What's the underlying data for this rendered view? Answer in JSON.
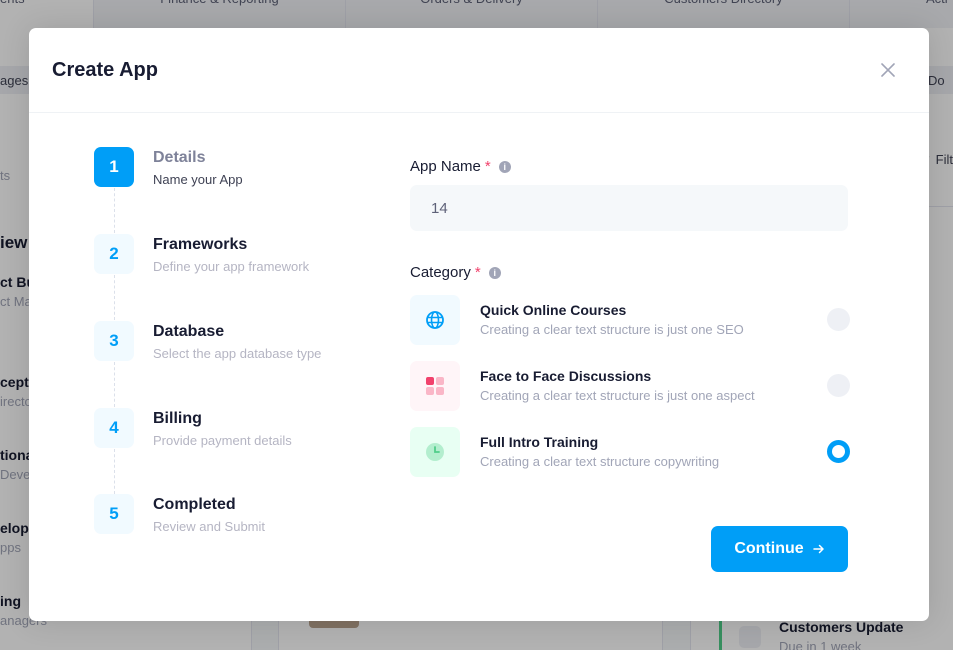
{
  "background": {
    "tabs": [
      "ents",
      "Finance & Reporting",
      "Orders & Delivery",
      "Customers Directory",
      "Acti"
    ],
    "left_pill": "ages",
    "right_pill": "Do",
    "filter_label": "Filt",
    "left_snippets": [
      "ts",
      "iew",
      "ct Bu",
      "ct Ma",
      "cept",
      "irecto",
      "tional",
      "Deve",
      "elopn",
      "pps",
      "ing",
      "anagers"
    ],
    "customers_update": "Customers Update",
    "due": "Due in 1 week"
  },
  "modal": {
    "title": "Create App",
    "steps": [
      {
        "number": "1",
        "title": "Details",
        "desc": "Name your App",
        "active": true
      },
      {
        "number": "2",
        "title": "Frameworks",
        "desc": "Define your app framework",
        "active": false
      },
      {
        "number": "3",
        "title": "Database",
        "desc": "Select the app database type",
        "active": false
      },
      {
        "number": "4",
        "title": "Billing",
        "desc": "Provide payment details",
        "active": false
      },
      {
        "number": "5",
        "title": "Completed",
        "desc": "Review and Submit",
        "active": false
      }
    ],
    "app_name_label": "App Name",
    "app_name_value": "14",
    "category_label": "Category",
    "categories": [
      {
        "title": "Quick Online Courses",
        "desc": "Creating a clear text structure is just one SEO",
        "icon": "globe-icon",
        "selected": false
      },
      {
        "title": "Face to Face Discussions",
        "desc": "Creating a clear text structure is just one aspect",
        "icon": "grid-icon",
        "selected": false
      },
      {
        "title": "Full Intro Training",
        "desc": "Creating a clear text structure copywriting",
        "icon": "clock-icon",
        "selected": true
      }
    ],
    "continue_label": "Continue"
  },
  "colors": {
    "primary": "#009ef7",
    "required": "#f1416c",
    "icon_globe_bg": "#f1faff",
    "icon_grid_bg": "#fff5f8",
    "icon_clock_bg": "#e8fff3",
    "icon_globe": "#009ef7",
    "icon_grid": "#f1416c",
    "icon_clock": "#50cd89"
  }
}
